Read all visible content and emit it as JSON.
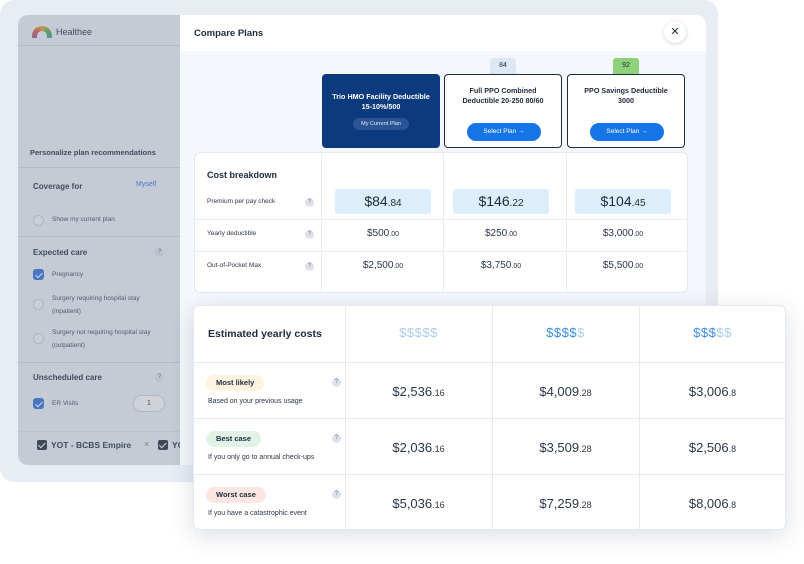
{
  "app": {
    "brand": "Healthee"
  },
  "sidebar": {
    "title": "Personalize plan recommendations",
    "coverage": {
      "label": "Coverage for",
      "value": "Myself"
    },
    "show_current_plan": "Show my current plan",
    "expected_care": {
      "label": "Expected care",
      "items": [
        {
          "label": "Pregnancy",
          "checked": true
        },
        {
          "label": "Surgery requiring hospital stay (inpatient)",
          "checked": false
        },
        {
          "label": "Surgery not requiring hospital stay (outpatient)",
          "checked": false
        }
      ]
    },
    "unscheduled_care": {
      "label": "Unscheduled care",
      "items": [
        {
          "label": "ER Visits",
          "checked": true,
          "count": "1"
        }
      ]
    },
    "selected_plans": [
      "YOT - BCBS Empire",
      "YO"
    ]
  },
  "modal": {
    "title": "Compare Plans",
    "close_icon": "close-icon",
    "plans": [
      {
        "name": "Trio HMO Facility Deductible 15-10%/500",
        "tag": "My Current Plan",
        "score": null
      },
      {
        "name": "Full PPO Combined Deductible 20-250 80/60",
        "button": "Select Plan",
        "score": "84",
        "score_color": "#dde8f6"
      },
      {
        "name": "PPO Savings Deductible 3000",
        "button": "Select Plan",
        "score": "92",
        "score_color": "#8fd07a"
      }
    ],
    "cost_breakdown": {
      "title": "Cost breakdown",
      "rows": [
        {
          "label": "Premium per pay check",
          "values": [
            {
              "main": "$84",
              "cents": ".84"
            },
            {
              "main": "$146",
              "cents": ".22"
            },
            {
              "main": "$104",
              "cents": ".45"
            }
          ]
        },
        {
          "label": "Yearly deductible",
          "values": [
            {
              "main": "$500",
              "cents": ".00"
            },
            {
              "main": "$250",
              "cents": ".00"
            },
            {
              "main": "$3,000",
              "cents": ".00"
            }
          ]
        },
        {
          "label": "Out-of-Pocket Max",
          "values": [
            {
              "main": "$2,500",
              "cents": ".00"
            },
            {
              "main": "$3,750",
              "cents": ".00"
            },
            {
              "main": "$5,500",
              "cents": ".00"
            }
          ]
        }
      ]
    }
  },
  "estimate": {
    "title": "Estimated yearly costs",
    "dollar_ratings": [
      {
        "active": "",
        "inactive": "$$$$$"
      },
      {
        "active": "$$$$",
        "inactive": "$"
      },
      {
        "active": "$$$",
        "inactive": "$$"
      }
    ],
    "scenarios": [
      {
        "badge": "Most likely",
        "badge_style": "likely",
        "desc": "Based on your previous usage",
        "values": [
          {
            "main": "$2,536",
            "cents": ".16"
          },
          {
            "main": "$4,009",
            "cents": ".28"
          },
          {
            "main": "$3,006",
            "cents": ".8"
          }
        ]
      },
      {
        "badge": "Best case",
        "badge_style": "best",
        "desc": "If you only go to annual check-ups",
        "values": [
          {
            "main": "$2,036",
            "cents": ".16"
          },
          {
            "main": "$3,509",
            "cents": ".28"
          },
          {
            "main": "$2,506",
            "cents": ".8"
          }
        ]
      },
      {
        "badge": "Worst case",
        "badge_style": "worst",
        "desc": "If you have a catastrophic event",
        "values": [
          {
            "main": "$5,036",
            "cents": ".16"
          },
          {
            "main": "$7,259",
            "cents": ".28"
          },
          {
            "main": "$8,006",
            "cents": ".8"
          }
        ]
      }
    ]
  }
}
